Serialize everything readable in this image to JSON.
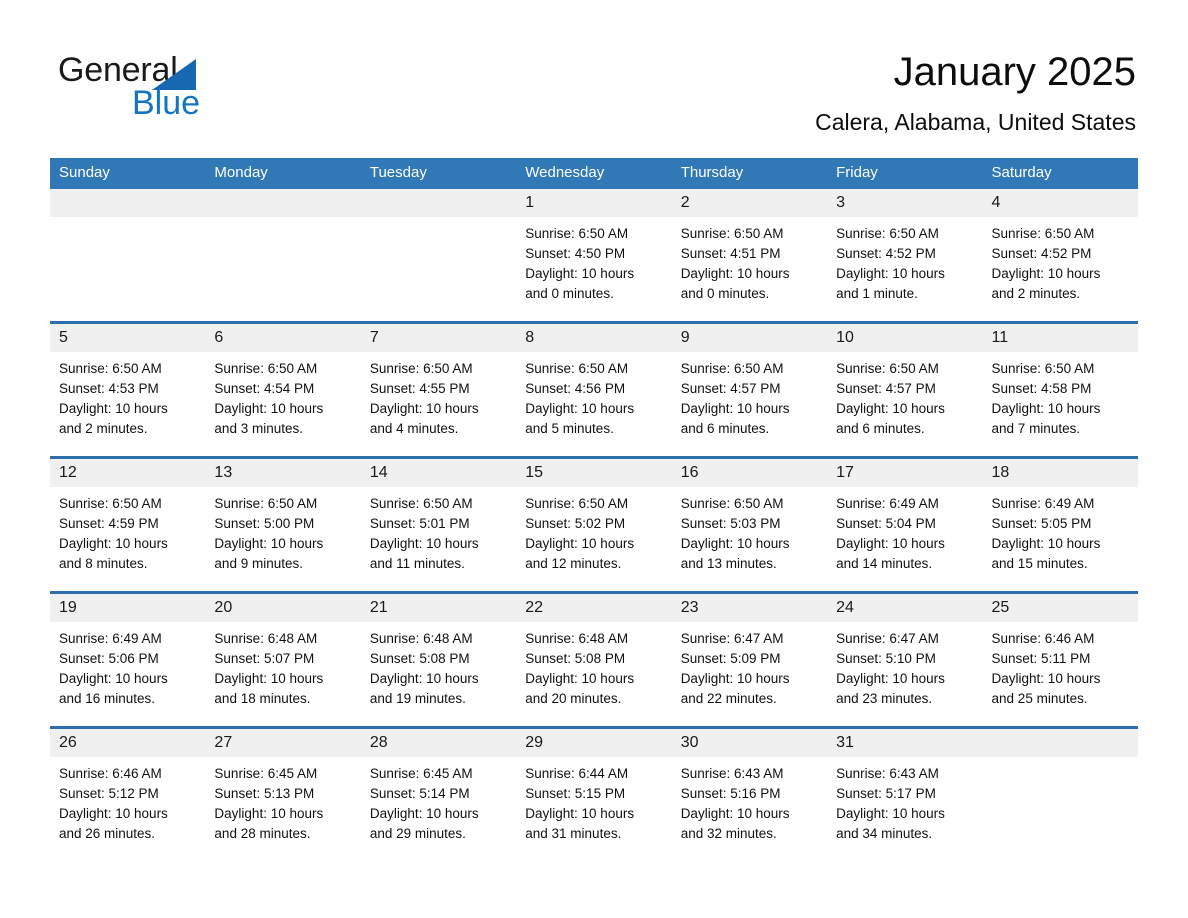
{
  "brand": {
    "name_line1": "General",
    "name_line2": "Blue",
    "accent_color": "#1675c0",
    "triangle_color": "#1669b0"
  },
  "header": {
    "month_title": "January 2025",
    "location": "Calera, Alabama, United States"
  },
  "calendar": {
    "header_bg": "#3178b6",
    "row_divider_color": "#2c6fab",
    "daynum_band_bg": "#f0f0f0",
    "weekday_headers": [
      "Sunday",
      "Monday",
      "Tuesday",
      "Wednesday",
      "Thursday",
      "Friday",
      "Saturday"
    ],
    "weeks": [
      [
        {
          "day": "",
          "lines": []
        },
        {
          "day": "",
          "lines": []
        },
        {
          "day": "",
          "lines": []
        },
        {
          "day": "1",
          "lines": [
            "Sunrise: 6:50 AM",
            "Sunset: 4:50 PM",
            "Daylight: 10 hours",
            "and 0 minutes."
          ]
        },
        {
          "day": "2",
          "lines": [
            "Sunrise: 6:50 AM",
            "Sunset: 4:51 PM",
            "Daylight: 10 hours",
            "and 0 minutes."
          ]
        },
        {
          "day": "3",
          "lines": [
            "Sunrise: 6:50 AM",
            "Sunset: 4:52 PM",
            "Daylight: 10 hours",
            "and 1 minute."
          ]
        },
        {
          "day": "4",
          "lines": [
            "Sunrise: 6:50 AM",
            "Sunset: 4:52 PM",
            "Daylight: 10 hours",
            "and 2 minutes."
          ]
        }
      ],
      [
        {
          "day": "5",
          "lines": [
            "Sunrise: 6:50 AM",
            "Sunset: 4:53 PM",
            "Daylight: 10 hours",
            "and 2 minutes."
          ]
        },
        {
          "day": "6",
          "lines": [
            "Sunrise: 6:50 AM",
            "Sunset: 4:54 PM",
            "Daylight: 10 hours",
            "and 3 minutes."
          ]
        },
        {
          "day": "7",
          "lines": [
            "Sunrise: 6:50 AM",
            "Sunset: 4:55 PM",
            "Daylight: 10 hours",
            "and 4 minutes."
          ]
        },
        {
          "day": "8",
          "lines": [
            "Sunrise: 6:50 AM",
            "Sunset: 4:56 PM",
            "Daylight: 10 hours",
            "and 5 minutes."
          ]
        },
        {
          "day": "9",
          "lines": [
            "Sunrise: 6:50 AM",
            "Sunset: 4:57 PM",
            "Daylight: 10 hours",
            "and 6 minutes."
          ]
        },
        {
          "day": "10",
          "lines": [
            "Sunrise: 6:50 AM",
            "Sunset: 4:57 PM",
            "Daylight: 10 hours",
            "and 6 minutes."
          ]
        },
        {
          "day": "11",
          "lines": [
            "Sunrise: 6:50 AM",
            "Sunset: 4:58 PM",
            "Daylight: 10 hours",
            "and 7 minutes."
          ]
        }
      ],
      [
        {
          "day": "12",
          "lines": [
            "Sunrise: 6:50 AM",
            "Sunset: 4:59 PM",
            "Daylight: 10 hours",
            "and 8 minutes."
          ]
        },
        {
          "day": "13",
          "lines": [
            "Sunrise: 6:50 AM",
            "Sunset: 5:00 PM",
            "Daylight: 10 hours",
            "and 9 minutes."
          ]
        },
        {
          "day": "14",
          "lines": [
            "Sunrise: 6:50 AM",
            "Sunset: 5:01 PM",
            "Daylight: 10 hours",
            "and 11 minutes."
          ]
        },
        {
          "day": "15",
          "lines": [
            "Sunrise: 6:50 AM",
            "Sunset: 5:02 PM",
            "Daylight: 10 hours",
            "and 12 minutes."
          ]
        },
        {
          "day": "16",
          "lines": [
            "Sunrise: 6:50 AM",
            "Sunset: 5:03 PM",
            "Daylight: 10 hours",
            "and 13 minutes."
          ]
        },
        {
          "day": "17",
          "lines": [
            "Sunrise: 6:49 AM",
            "Sunset: 5:04 PM",
            "Daylight: 10 hours",
            "and 14 minutes."
          ]
        },
        {
          "day": "18",
          "lines": [
            "Sunrise: 6:49 AM",
            "Sunset: 5:05 PM",
            "Daylight: 10 hours",
            "and 15 minutes."
          ]
        }
      ],
      [
        {
          "day": "19",
          "lines": [
            "Sunrise: 6:49 AM",
            "Sunset: 5:06 PM",
            "Daylight: 10 hours",
            "and 16 minutes."
          ]
        },
        {
          "day": "20",
          "lines": [
            "Sunrise: 6:48 AM",
            "Sunset: 5:07 PM",
            "Daylight: 10 hours",
            "and 18 minutes."
          ]
        },
        {
          "day": "21",
          "lines": [
            "Sunrise: 6:48 AM",
            "Sunset: 5:08 PM",
            "Daylight: 10 hours",
            "and 19 minutes."
          ]
        },
        {
          "day": "22",
          "lines": [
            "Sunrise: 6:48 AM",
            "Sunset: 5:08 PM",
            "Daylight: 10 hours",
            "and 20 minutes."
          ]
        },
        {
          "day": "23",
          "lines": [
            "Sunrise: 6:47 AM",
            "Sunset: 5:09 PM",
            "Daylight: 10 hours",
            "and 22 minutes."
          ]
        },
        {
          "day": "24",
          "lines": [
            "Sunrise: 6:47 AM",
            "Sunset: 5:10 PM",
            "Daylight: 10 hours",
            "and 23 minutes."
          ]
        },
        {
          "day": "25",
          "lines": [
            "Sunrise: 6:46 AM",
            "Sunset: 5:11 PM",
            "Daylight: 10 hours",
            "and 25 minutes."
          ]
        }
      ],
      [
        {
          "day": "26",
          "lines": [
            "Sunrise: 6:46 AM",
            "Sunset: 5:12 PM",
            "Daylight: 10 hours",
            "and 26 minutes."
          ]
        },
        {
          "day": "27",
          "lines": [
            "Sunrise: 6:45 AM",
            "Sunset: 5:13 PM",
            "Daylight: 10 hours",
            "and 28 minutes."
          ]
        },
        {
          "day": "28",
          "lines": [
            "Sunrise: 6:45 AM",
            "Sunset: 5:14 PM",
            "Daylight: 10 hours",
            "and 29 minutes."
          ]
        },
        {
          "day": "29",
          "lines": [
            "Sunrise: 6:44 AM",
            "Sunset: 5:15 PM",
            "Daylight: 10 hours",
            "and 31 minutes."
          ]
        },
        {
          "day": "30",
          "lines": [
            "Sunrise: 6:43 AM",
            "Sunset: 5:16 PM",
            "Daylight: 10 hours",
            "and 32 minutes."
          ]
        },
        {
          "day": "31",
          "lines": [
            "Sunrise: 6:43 AM",
            "Sunset: 5:17 PM",
            "Daylight: 10 hours",
            "and 34 minutes."
          ]
        },
        {
          "day": "",
          "lines": []
        }
      ]
    ]
  }
}
